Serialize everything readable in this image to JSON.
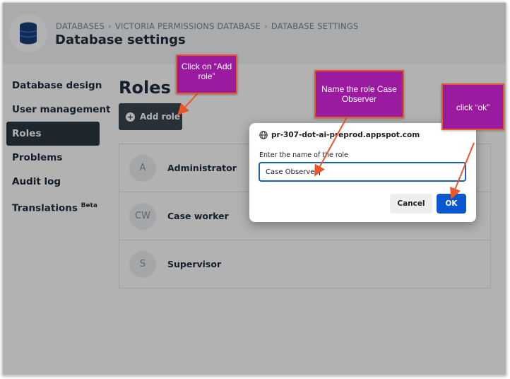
{
  "header": {
    "breadcrumb": [
      "DATABASES",
      "VICTORIA PERMISSIONS DATABASE",
      "DATABASE SETTINGS"
    ],
    "breadcrumb_separator": "›",
    "title": "Database settings"
  },
  "sidebar": {
    "items": [
      {
        "label": "Database design",
        "active": false
      },
      {
        "label": "User management",
        "active": false
      },
      {
        "label": "Roles",
        "active": true
      },
      {
        "label": "Problems",
        "active": false
      },
      {
        "label": "Audit log",
        "active": false
      },
      {
        "label": "Translations",
        "badge": "Beta",
        "active": false
      }
    ]
  },
  "main": {
    "heading": "Roles",
    "add_role_label": "Add role",
    "roles": [
      {
        "initials": "A",
        "name": "Administrator"
      },
      {
        "initials": "CW",
        "name": "Case worker"
      },
      {
        "initials": "S",
        "name": "Supervisor"
      }
    ]
  },
  "dialog": {
    "origin": "pr-307-dot-ai-preprod.appspot.com",
    "label": "Enter the name of the role",
    "input_value": "Case Observer",
    "cancel_label": "Cancel",
    "ok_label": "OK"
  },
  "annotations": {
    "add_role_note": "Click on “Add role”",
    "name_role_note": "Name the role Case Observer",
    "ok_note": "click “ok”"
  },
  "colors": {
    "sidebar_active": "#2b3743",
    "dialog_ok": "#0b57d0",
    "callout_fill": "#9a1aa0",
    "callout_border": "#e8562a"
  }
}
